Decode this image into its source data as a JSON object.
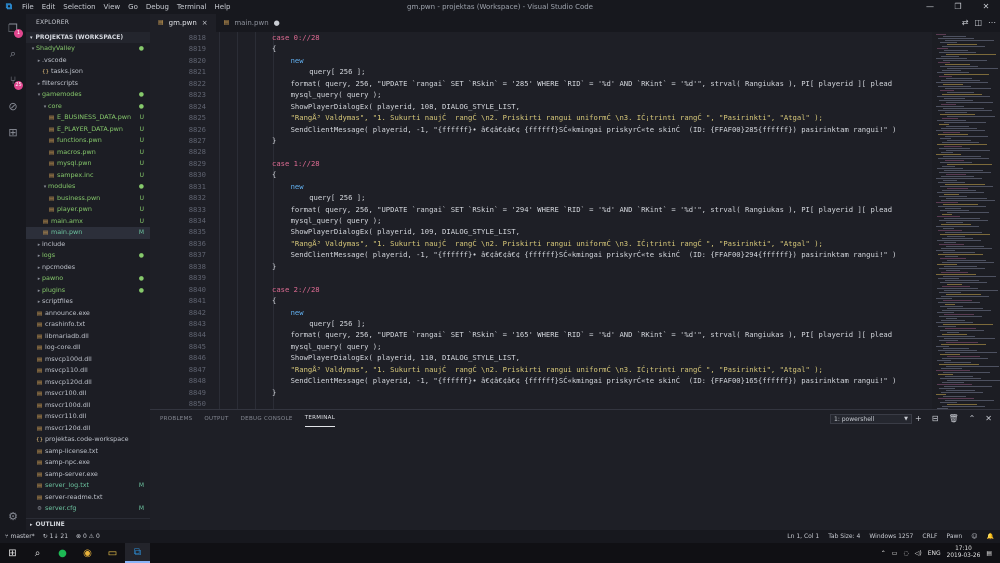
{
  "titlebar": {
    "menu": [
      "File",
      "Edit",
      "Selection",
      "View",
      "Go",
      "Debug",
      "Terminal",
      "Help"
    ],
    "title": "gm.pwn - projektas (Workspace) - Visual Studio Code",
    "controls": [
      "—",
      "❐",
      "✕"
    ]
  },
  "activity": {
    "items": [
      {
        "name": "explorer-icon",
        "glyph": "❐",
        "badge": "1"
      },
      {
        "name": "search-icon",
        "glyph": "⌕",
        "badge": ""
      },
      {
        "name": "source-control-icon",
        "glyph": "⑂",
        "badge": "25"
      },
      {
        "name": "debug-icon",
        "glyph": "⊘",
        "badge": ""
      },
      {
        "name": "extensions-icon",
        "glyph": "⊞",
        "badge": ""
      }
    ],
    "settings_glyph": "⚙"
  },
  "sidebar": {
    "title": "EXPLORER",
    "workspace": "PROJEKTAS (WORKSPACE)",
    "outline": "OUTLINE",
    "tree": [
      {
        "label": "ShadyValley",
        "depth": 0,
        "type": "folder",
        "open": true,
        "status": "●",
        "color": "green"
      },
      {
        "label": ".vscode",
        "depth": 1,
        "type": "folder",
        "open": false,
        "status": "",
        "color": ""
      },
      {
        "label": "tasks.json",
        "depth": 2,
        "type": "json",
        "status": "",
        "color": ""
      },
      {
        "label": "filterscripts",
        "depth": 1,
        "type": "folder",
        "open": false,
        "status": "",
        "color": ""
      },
      {
        "label": "gamemodes",
        "depth": 1,
        "type": "folder",
        "open": true,
        "status": "●",
        "color": "green"
      },
      {
        "label": "core",
        "depth": 2,
        "type": "folder",
        "open": true,
        "status": "●",
        "color": "green"
      },
      {
        "label": "E_BUSINESS_DATA.pwn",
        "depth": 3,
        "type": "file",
        "status": "U",
        "color": "green"
      },
      {
        "label": "E_PLAYER_DATA.pwn",
        "depth": 3,
        "type": "file",
        "status": "U",
        "color": "green"
      },
      {
        "label": "functions.pwn",
        "depth": 3,
        "type": "file",
        "status": "U",
        "color": "green"
      },
      {
        "label": "macros.pwn",
        "depth": 3,
        "type": "file",
        "status": "U",
        "color": "green"
      },
      {
        "label": "mysql.pwn",
        "depth": 3,
        "type": "file",
        "status": "U",
        "color": "green"
      },
      {
        "label": "sampex.inc",
        "depth": 3,
        "type": "file",
        "status": "U",
        "color": "green"
      },
      {
        "label": "modules",
        "depth": 2,
        "type": "folder",
        "open": true,
        "status": "●",
        "color": "green"
      },
      {
        "label": "business.pwn",
        "depth": 3,
        "type": "file",
        "status": "U",
        "color": "green"
      },
      {
        "label": "player.pwn",
        "depth": 3,
        "type": "file",
        "status": "U",
        "color": "green"
      },
      {
        "label": "main.amx",
        "depth": 2,
        "type": "file",
        "status": "U",
        "color": "green"
      },
      {
        "label": "main.pwn",
        "depth": 2,
        "type": "file",
        "status": "M",
        "color": "teal",
        "selected": true
      },
      {
        "label": "include",
        "depth": 1,
        "type": "folder",
        "open": false,
        "status": "",
        "color": ""
      },
      {
        "label": "logs",
        "depth": 1,
        "type": "folder",
        "open": false,
        "status": "●",
        "color": "green"
      },
      {
        "label": "npcmodes",
        "depth": 1,
        "type": "folder",
        "open": false,
        "status": "",
        "color": ""
      },
      {
        "label": "pawno",
        "depth": 1,
        "type": "folder",
        "open": false,
        "status": "●",
        "color": "green"
      },
      {
        "label": "plugins",
        "depth": 1,
        "type": "folder",
        "open": false,
        "status": "●",
        "color": "green"
      },
      {
        "label": "scriptfiles",
        "depth": 1,
        "type": "folder",
        "open": false,
        "status": "",
        "color": ""
      },
      {
        "label": "announce.exe",
        "depth": 1,
        "type": "file",
        "status": "",
        "color": ""
      },
      {
        "label": "crashinfo.txt",
        "depth": 1,
        "type": "file",
        "status": "",
        "color": ""
      },
      {
        "label": "libmariadb.dll",
        "depth": 1,
        "type": "file",
        "status": "",
        "color": ""
      },
      {
        "label": "log-core.dll",
        "depth": 1,
        "type": "file",
        "status": "",
        "color": ""
      },
      {
        "label": "msvcp100d.dll",
        "depth": 1,
        "type": "file",
        "status": "",
        "color": ""
      },
      {
        "label": "msvcp110.dll",
        "depth": 1,
        "type": "file",
        "status": "",
        "color": ""
      },
      {
        "label": "msvcp120d.dll",
        "depth": 1,
        "type": "file",
        "status": "",
        "color": ""
      },
      {
        "label": "msvcr100.dll",
        "depth": 1,
        "type": "file",
        "status": "",
        "color": ""
      },
      {
        "label": "msvcr100d.dll",
        "depth": 1,
        "type": "file",
        "status": "",
        "color": ""
      },
      {
        "label": "msvcr110.dll",
        "depth": 1,
        "type": "file",
        "status": "",
        "color": ""
      },
      {
        "label": "msvcr120d.dll",
        "depth": 1,
        "type": "file",
        "status": "",
        "color": ""
      },
      {
        "label": "projektas.code-workspace",
        "depth": 1,
        "type": "json",
        "status": "",
        "color": ""
      },
      {
        "label": "samp-license.txt",
        "depth": 1,
        "type": "file",
        "status": "",
        "color": ""
      },
      {
        "label": "samp-npc.exe",
        "depth": 1,
        "type": "file",
        "status": "",
        "color": ""
      },
      {
        "label": "samp-server.exe",
        "depth": 1,
        "type": "file",
        "status": "",
        "color": ""
      },
      {
        "label": "server_log.txt",
        "depth": 1,
        "type": "file",
        "status": "M",
        "color": "teal"
      },
      {
        "label": "server-readme.txt",
        "depth": 1,
        "type": "file",
        "status": "",
        "color": ""
      },
      {
        "label": "server.cfg",
        "depth": 1,
        "type": "gear",
        "status": "M",
        "color": "teal"
      }
    ]
  },
  "tabs": [
    {
      "label": "gm.pwn",
      "active": true,
      "marker": "×"
    },
    {
      "label": "main.pwn",
      "active": false,
      "marker": "●"
    }
  ],
  "editor": {
    "lines": [
      {
        "n": "8818",
        "indent": 2,
        "code": "case 0://28",
        "kind": "case"
      },
      {
        "n": "8819",
        "indent": 2,
        "code": "{",
        "kind": "plain"
      },
      {
        "n": "8820",
        "indent": 3,
        "code": "new",
        "kind": "new"
      },
      {
        "n": "8821",
        "indent": 4,
        "code": "query[ 256 ];",
        "kind": "plain"
      },
      {
        "n": "8822",
        "indent": 3,
        "code": "format( query, 256, \"UPDATE `rangai` SET `RSkin` = '285' WHERE `RID` = '%d' AND `RKint` = '%d'\", strval( Rangiukas ), PI[ playerid ][ plead",
        "kind": "fmt"
      },
      {
        "n": "8823",
        "indent": 3,
        "code": "mysql_query( query );",
        "kind": "fn"
      },
      {
        "n": "8824",
        "indent": 3,
        "code": "ShowPlayerDialogEx( playerid, 108, DIALOG_STYLE_LIST,",
        "kind": "fn"
      },
      {
        "n": "8825",
        "indent": 3,
        "code": "\"RangÅ³ Valdymas\", \"1. Sukurti naujĆ  rangĆ \\n2. Priskirti rangui uniformĆ \\n3. IĆ¡trinti rangĆ \", \"Pasirinkti\", \"Atgal\" );",
        "kind": "str"
      },
      {
        "n": "8826",
        "indent": 3,
        "code": "SendClientMessage( playerid, -1, \"{ffffff}• â€¢â€¢â€¢ {ffffff}SĆ«kmingai priskyrĆ«te skinĆ  (ID: {FFAF00}285{ffffff}) pasirinktam rangui!\" )",
        "kind": "fn"
      },
      {
        "n": "8827",
        "indent": 2,
        "code": "}",
        "kind": "plain"
      },
      {
        "n": "8828",
        "indent": 0,
        "code": "",
        "kind": "plain"
      },
      {
        "n": "8829",
        "indent": 2,
        "code": "case 1://28",
        "kind": "case"
      },
      {
        "n": "8830",
        "indent": 2,
        "code": "{",
        "kind": "plain"
      },
      {
        "n": "8831",
        "indent": 3,
        "code": "new",
        "kind": "new"
      },
      {
        "n": "8832",
        "indent": 4,
        "code": "query[ 256 ];",
        "kind": "plain"
      },
      {
        "n": "8833",
        "indent": 3,
        "code": "format( query, 256, \"UPDATE `rangai` SET `RSkin` = '294' WHERE `RID` = '%d' AND `RKint` = '%d'\", strval( Rangiukas ), PI[ playerid ][ plead",
        "kind": "fmt"
      },
      {
        "n": "8834",
        "indent": 3,
        "code": "mysql_query( query );",
        "kind": "fn"
      },
      {
        "n": "8835",
        "indent": 3,
        "code": "ShowPlayerDialogEx( playerid, 109, DIALOG_STYLE_LIST,",
        "kind": "fn"
      },
      {
        "n": "8836",
        "indent": 3,
        "code": "\"RangÅ³ Valdymas\", \"1. Sukurti naujĆ  rangĆ \\n2. Priskirti rangui uniformĆ \\n3. IĆ¡trinti rangĆ \", \"Pasirinkti\", \"Atgal\" );",
        "kind": "str"
      },
      {
        "n": "8837",
        "indent": 3,
        "code": "SendClientMessage( playerid, -1, \"{ffffff}• â€¢â€¢â€¢ {ffffff}SĆ«kmingai priskyrĆ«te skinĆ  (ID: {FFAF00}294{ffffff}) pasirinktam rangui!\" )",
        "kind": "fn"
      },
      {
        "n": "8838",
        "indent": 2,
        "code": "}",
        "kind": "plain"
      },
      {
        "n": "8839",
        "indent": 0,
        "code": "",
        "kind": "plain"
      },
      {
        "n": "8840",
        "indent": 2,
        "code": "case 2://28",
        "kind": "case"
      },
      {
        "n": "8841",
        "indent": 2,
        "code": "{",
        "kind": "plain"
      },
      {
        "n": "8842",
        "indent": 3,
        "code": "new",
        "kind": "new"
      },
      {
        "n": "8843",
        "indent": 4,
        "code": "query[ 256 ];",
        "kind": "plain"
      },
      {
        "n": "8844",
        "indent": 3,
        "code": "format( query, 256, \"UPDATE `rangai` SET `RSkin` = '165' WHERE `RID` = '%d' AND `RKint` = '%d'\", strval( Rangiukas ), PI[ playerid ][ plead",
        "kind": "fmt"
      },
      {
        "n": "8845",
        "indent": 3,
        "code": "mysql_query( query );",
        "kind": "fn"
      },
      {
        "n": "8846",
        "indent": 3,
        "code": "ShowPlayerDialogEx( playerid, 110, DIALOG_STYLE_LIST,",
        "kind": "fn"
      },
      {
        "n": "8847",
        "indent": 3,
        "code": "\"RangÅ³ Valdymas\", \"1. Sukurti naujĆ  rangĆ \\n2. Priskirti rangui uniformĆ \\n3. IĆ¡trinti rangĆ \", \"Pasirinkti\", \"Atgal\" );",
        "kind": "str"
      },
      {
        "n": "8848",
        "indent": 3,
        "code": "SendClientMessage( playerid, -1, \"{ffffff}• â€¢â€¢â€¢ {ffffff}SĆ«kmingai priskyrĆ«te skinĆ  (ID: {FFAF00}165{ffffff}) pasirinktam rangui!\" )",
        "kind": "fn"
      },
      {
        "n": "8849",
        "indent": 2,
        "code": "}",
        "kind": "plain"
      },
      {
        "n": "8850",
        "indent": 0,
        "code": "",
        "kind": "plain"
      }
    ]
  },
  "panel": {
    "tabs": [
      "PROBLEMS",
      "OUTPUT",
      "DEBUG CONSOLE",
      "TERMINAL"
    ],
    "active_tab": "TERMINAL",
    "terminal_select": "1: powershell",
    "actions": [
      "+",
      "⊟",
      "🗑",
      "⌃",
      "✕"
    ]
  },
  "statusbar": {
    "branch": "master*",
    "sync": "↻ 1↓ 21",
    "problems": "⊗ 0 ⚠ 0",
    "position": "Ln 1, Col 1",
    "tab_size": "Tab Size: 4",
    "encoding": "Windows 1257",
    "eol": "CRLF",
    "language": "Pawn",
    "feedback": "☺",
    "notifications": "🔔"
  },
  "taskbar": {
    "apps": [
      {
        "name": "windows-start-icon",
        "glyph": "⊞",
        "active": false
      },
      {
        "name": "search-icon",
        "glyph": "⌕",
        "active": false
      },
      {
        "name": "spotify-icon",
        "glyph": "●",
        "active": false
      },
      {
        "name": "chrome-icon",
        "glyph": "◉",
        "active": false
      },
      {
        "name": "file-explorer-icon",
        "glyph": "▭",
        "active": false
      },
      {
        "name": "vscode-icon",
        "glyph": "⧉",
        "active": true
      }
    ],
    "tray": {
      "lang": "ENG",
      "time": "17:10",
      "date": "2019-03-26"
    }
  },
  "colors": {
    "background": "#1e1f26",
    "sidebar": "#1c1d24",
    "titlebar": "#17181e",
    "accent": "#2b8fd8",
    "git_untracked": "#86c96b",
    "git_modified": "#6cc4a0"
  }
}
